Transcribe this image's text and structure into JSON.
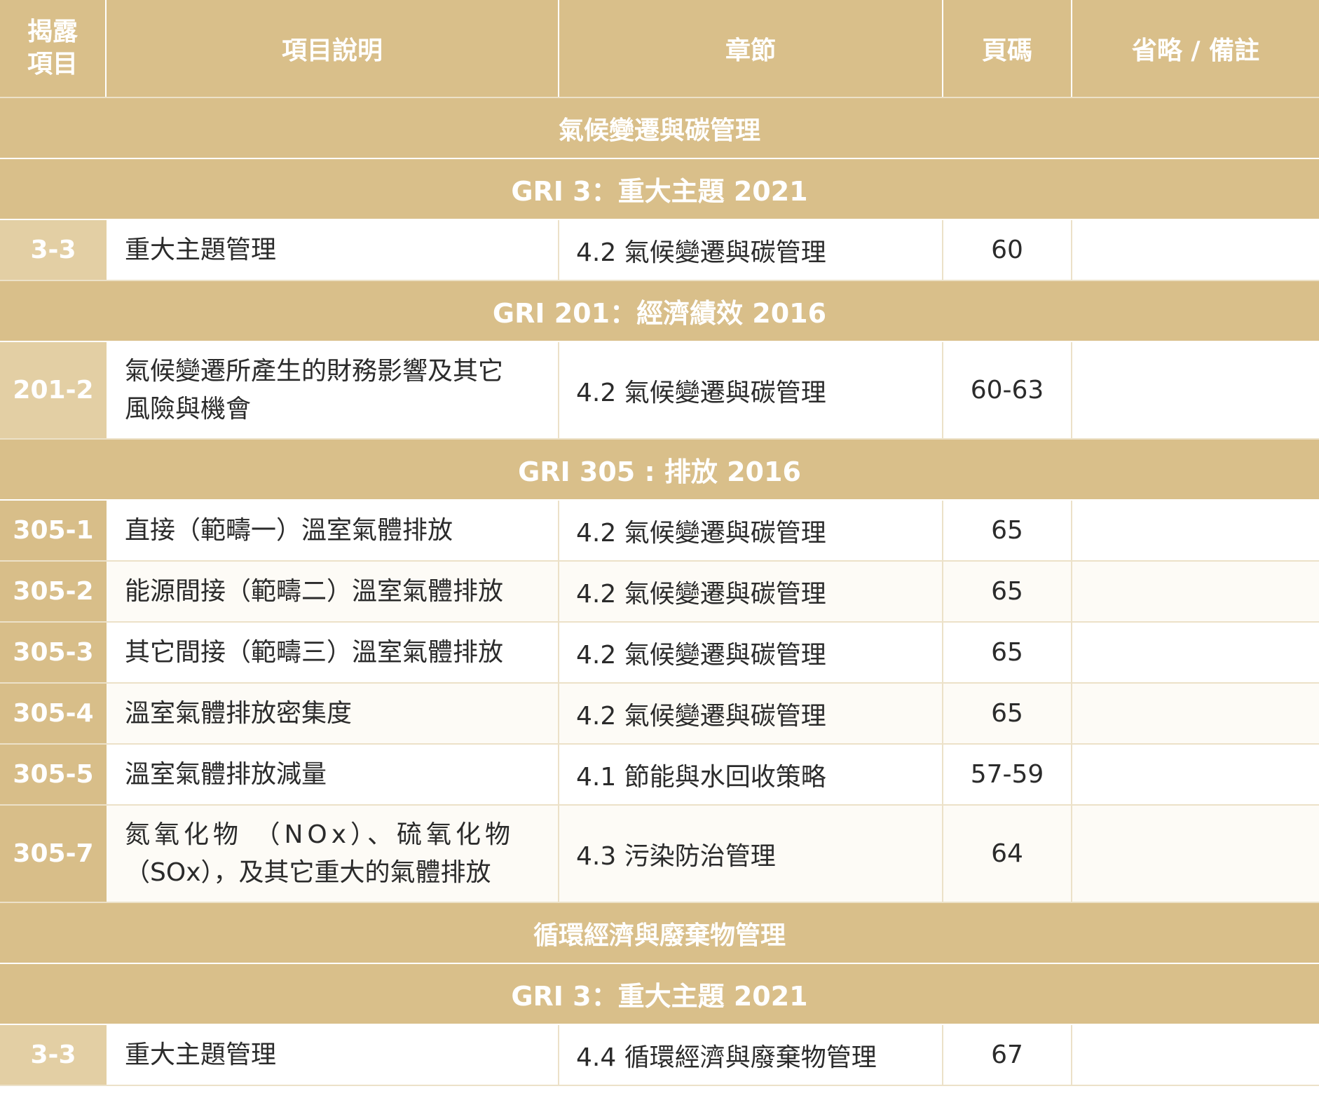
{
  "header": {
    "col1_line1": "揭露",
    "col1_line2": "項目",
    "col2": "項目說明",
    "col3": "章節",
    "col4": "頁碼",
    "col5": "省略 / 備註"
  },
  "sections": {
    "climate_title": "氣候變遷與碳管理",
    "climate_gri3": "GRI 3：重大主題 2021",
    "climate_gri201": "GRI 201：經濟績效 2016",
    "climate_gri305": "GRI 305 : 排放 2016",
    "circular_title": "循環經濟與廢棄物管理",
    "circular_gri3": "GRI 3：重大主題 2021"
  },
  "rows": {
    "r1": {
      "code": "3-3",
      "desc": "重大主題管理",
      "chapter": "4.2 氣候變遷與碳管理",
      "page": "60",
      "note": ""
    },
    "r2": {
      "code": "201-2",
      "desc_line1": "氣候變遷所產生的財務影響及其它",
      "desc_line2": "風險與機會",
      "chapter": "4.2 氣候變遷與碳管理",
      "page": "60-63",
      "note": ""
    },
    "r3": {
      "code": "305-1",
      "desc": "直接（範疇一）溫室氣體排放",
      "chapter": "4.2 氣候變遷與碳管理",
      "page": "65",
      "note": ""
    },
    "r4": {
      "code": "305-2",
      "desc": "能源間接（範疇二）溫室氣體排放",
      "chapter": "4.2 氣候變遷與碳管理",
      "page": "65",
      "note": ""
    },
    "r5": {
      "code": "305-3",
      "desc": "其它間接（範疇三）溫室氣體排放",
      "chapter": "4.2 氣候變遷與碳管理",
      "page": "65",
      "note": ""
    },
    "r6": {
      "code": "305-4",
      "desc": "溫室氣體排放密集度",
      "chapter": "4.2 氣候變遷與碳管理",
      "page": "65",
      "note": ""
    },
    "r7": {
      "code": "305-5",
      "desc": "溫室氣體排放減量",
      "chapter": "4.1 節能與水回收策略",
      "page": "57-59",
      "note": ""
    },
    "r8": {
      "code": "305-7",
      "desc_line1": "氮氧化物 （NOx）、硫氧化物",
      "desc_line2": "（SOx），及其它重大的氣體排放",
      "chapter": "4.3 污染防治管理",
      "page": "64",
      "note": ""
    },
    "r9": {
      "code": "3-3",
      "desc": "重大主題管理",
      "chapter": "4.4 循環經濟與廢棄物管理",
      "page": "67",
      "note": ""
    }
  },
  "colors": {
    "header_bg": "#d9bf8a",
    "code_cell_bg": "#d8be89",
    "text": "#2b2b2b"
  }
}
